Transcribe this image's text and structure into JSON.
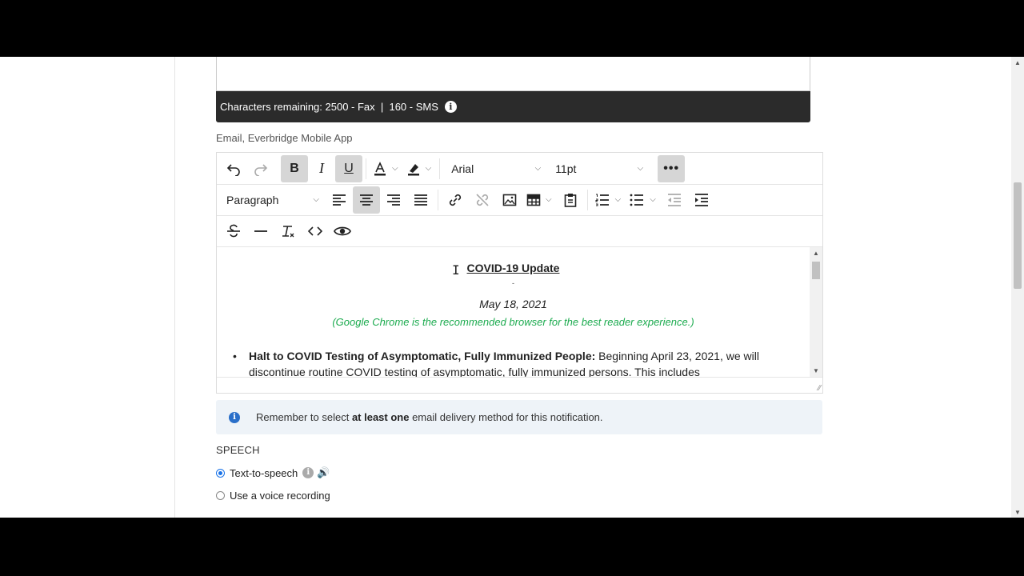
{
  "char_bar": {
    "text": "Characters remaining: 2500 - Fax  |  160 - SMS"
  },
  "channel_label": "Email, Everbridge Mobile App",
  "toolbar": {
    "font_family": "Arial",
    "font_size": "11pt",
    "block_format": "Paragraph"
  },
  "content": {
    "title": "COVID-19 Update",
    "dash": "-",
    "date": "May 18, 2021",
    "note": "(Google Chrome is the recommended browser for the best reader experience.)",
    "bullet_lead": "Halt to COVID Testing of Asymptomatic, Fully Immunized People:",
    "bullet_text": " Beginning April 23, 2021, we will discontinue routine COVID testing of asymptomatic, fully immunized persons.  This includes"
  },
  "alert": {
    "pre": "Remember to select ",
    "bold": "at least one",
    "post": " email delivery method for this notification."
  },
  "speech": {
    "heading": "SPEECH",
    "option_tts": "Text-to-speech",
    "option_recording": "Use a voice recording",
    "selected": "Text-to-speech"
  },
  "colors": {
    "note_green": "#1cab4f",
    "info_blue": "#2a6fc9",
    "dark_bar": "#2b2b2b"
  }
}
